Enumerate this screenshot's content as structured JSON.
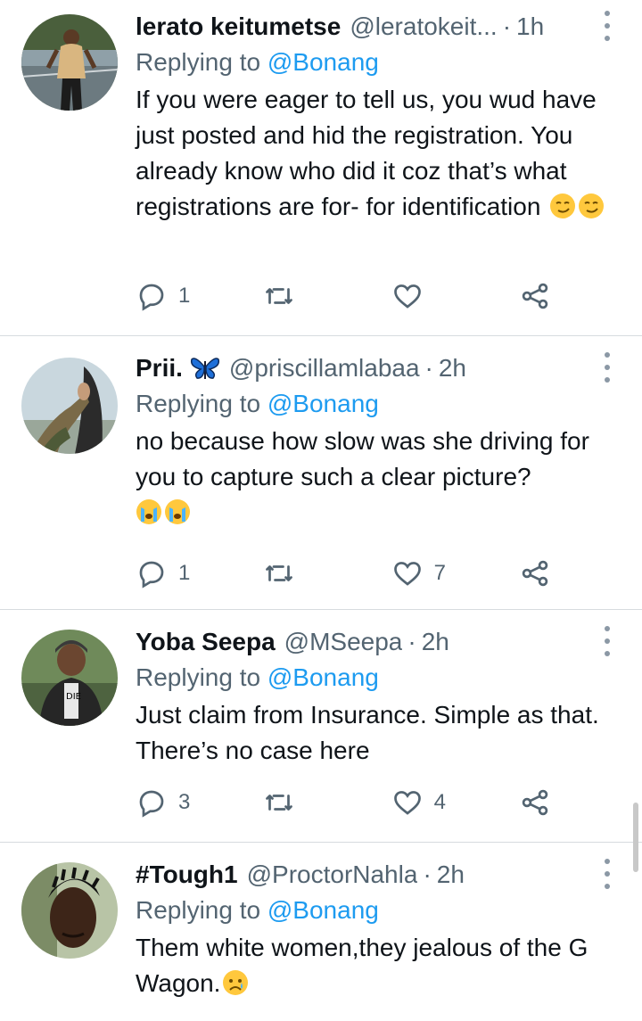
{
  "tweets": [
    {
      "name": "lerato keitumetse",
      "handle": "@leratokeit...",
      "time": "1h",
      "replying_prefix": "Replying to",
      "replying_to": "@Bonang",
      "text": "If you were eager to tell us, you wud have just posted and hid the registration. You already know who did it coz that’s what registrations are for- for identification",
      "emojis": [
        "smirking-face",
        "smirking-face"
      ],
      "reply_count": "1",
      "retweet_count": "",
      "like_count": ""
    },
    {
      "name": "Prii.",
      "name_emoji": "butterfly",
      "handle": "@priscillamlabaa",
      "time": "2h",
      "replying_prefix": "Replying to",
      "replying_to": "@Bonang",
      "text": "no because how slow was she driving for you to capture such a  clear picture?",
      "emojis": [
        "crying-face",
        "crying-face"
      ],
      "reply_count": "1",
      "retweet_count": "",
      "like_count": "7"
    },
    {
      "name": "Yoba Seepa",
      "handle": "@MSeepa",
      "time": "2h",
      "replying_prefix": "Replying to",
      "replying_to": "@Bonang",
      "text": "Just claim from Insurance. Simple as that. There’s no case here",
      "emojis": [],
      "reply_count": "3",
      "retweet_count": "",
      "like_count": "4"
    },
    {
      "name": "#Tough1",
      "handle": "@ProctorNahla",
      "time": "2h",
      "replying_prefix": "Replying to",
      "replying_to": "@Bonang",
      "text": "Them white women,they jealous of the G Wagon.",
      "emojis": [
        "sad-face"
      ],
      "reply_count": "",
      "retweet_count": "",
      "like_count": ""
    }
  ],
  "colors": {
    "accent": "#1d9bf0",
    "secondary_text": "#536471",
    "divider": "#d7dbdf"
  }
}
